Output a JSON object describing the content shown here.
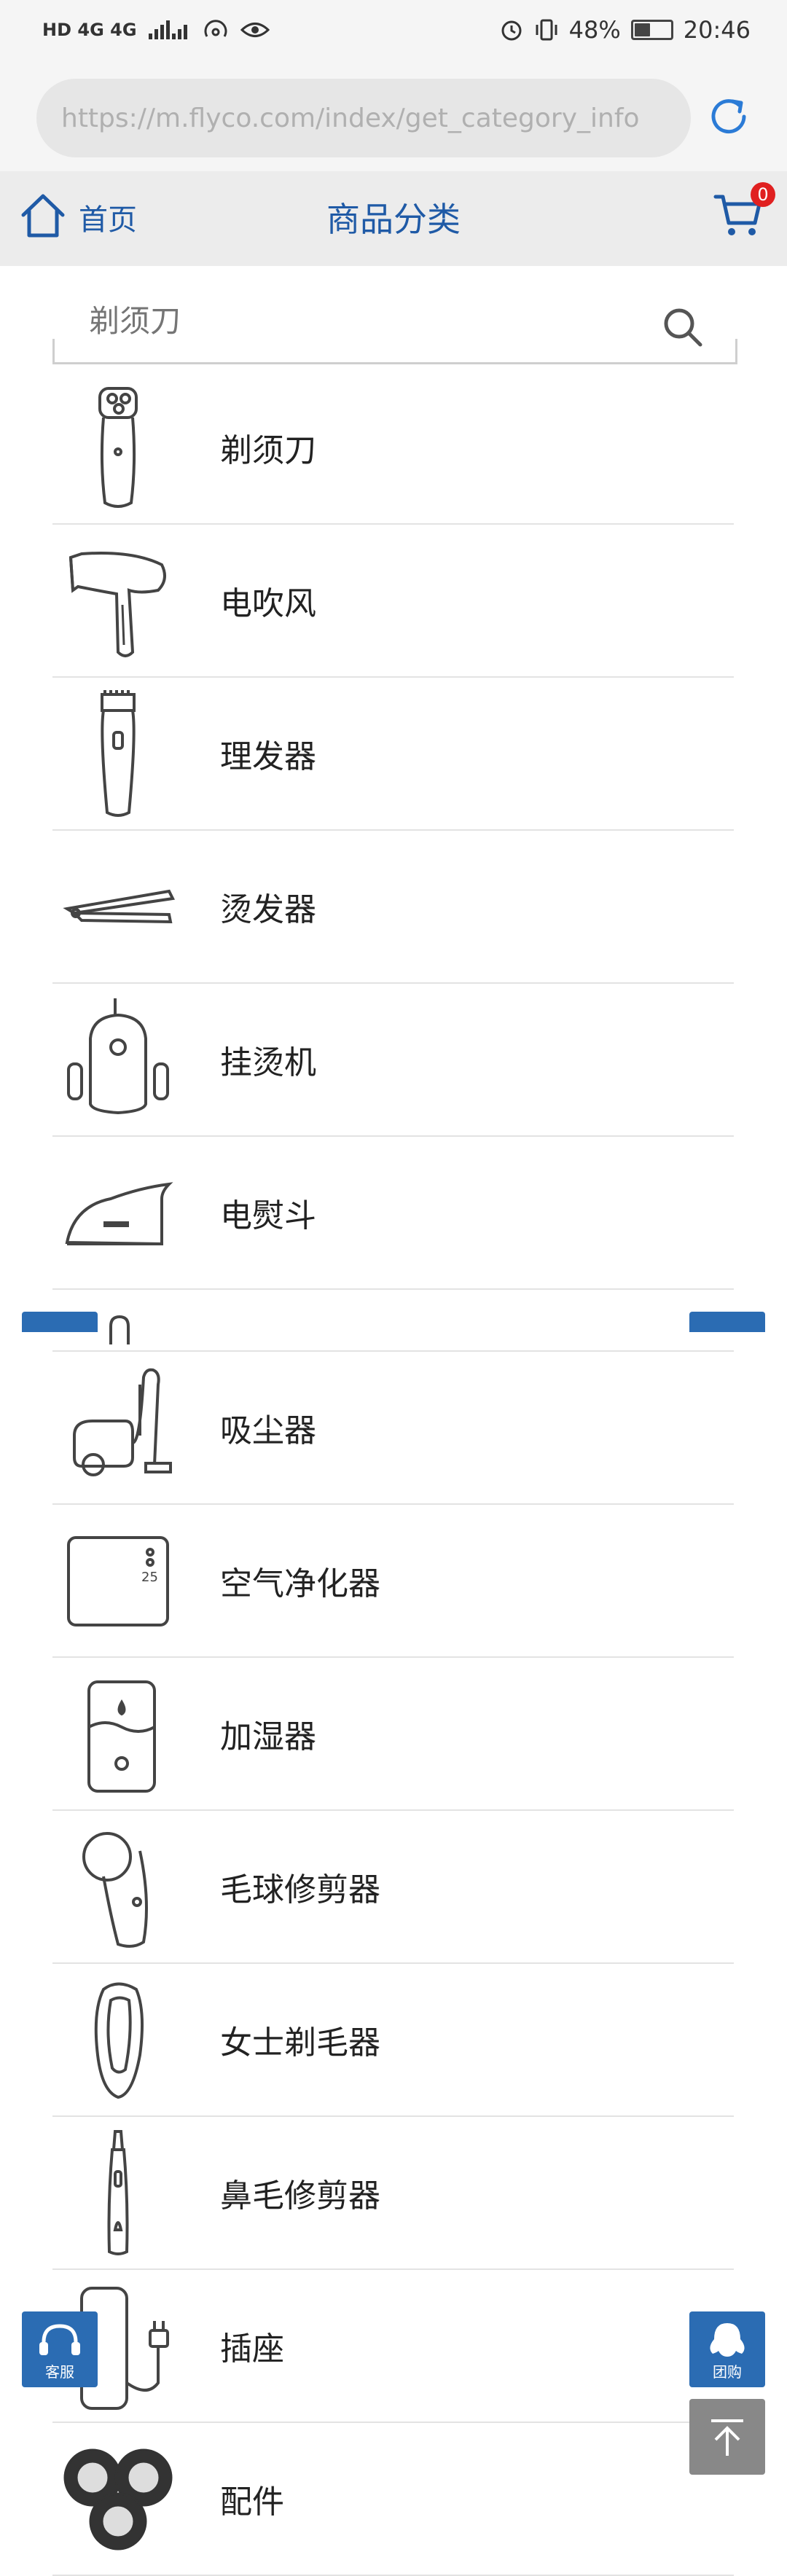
{
  "status_bar": {
    "left_text": "HD 4G 4G",
    "battery": "48%",
    "time": "20:46",
    "battery_level": 0.48
  },
  "browser": {
    "url": "https://m.flyco.com/index/get_category_info"
  },
  "header": {
    "home_label": "首页",
    "title": "商品分类",
    "cart_count": "0"
  },
  "search": {
    "placeholder": "剃须刀"
  },
  "categories": [
    {
      "label": "剃须刀",
      "icon": "shaver-icon"
    },
    {
      "label": "电吹风",
      "icon": "hair-dryer-icon"
    },
    {
      "label": "理发器",
      "icon": "hair-clipper-icon"
    },
    {
      "label": "烫发器",
      "icon": "hair-straightener-icon"
    },
    {
      "label": "挂烫机",
      "icon": "garment-steamer-icon"
    },
    {
      "label": "电熨斗",
      "icon": "iron-icon"
    },
    {
      "label": "",
      "icon": "partial-item-icon"
    },
    {
      "label": "吸尘器",
      "icon": "vacuum-cleaner-icon"
    },
    {
      "label": "空气净化器",
      "icon": "air-purifier-icon"
    },
    {
      "label": "加湿器",
      "icon": "humidifier-icon"
    },
    {
      "label": "毛球修剪器",
      "icon": "lint-remover-icon"
    },
    {
      "label": "女士剃毛器",
      "icon": "lady-shaver-icon"
    },
    {
      "label": "鼻毛修剪器",
      "icon": "nose-trimmer-icon"
    },
    {
      "label": "插座",
      "icon": "power-strip-icon"
    },
    {
      "label": "配件",
      "icon": "shaver-heads-icon"
    }
  ],
  "floating": {
    "service_label": "客服",
    "group_label": "团购"
  },
  "colors": {
    "accent": "#1f5aa6",
    "float_button": "#2b6cb3",
    "badge": "#e02020"
  }
}
